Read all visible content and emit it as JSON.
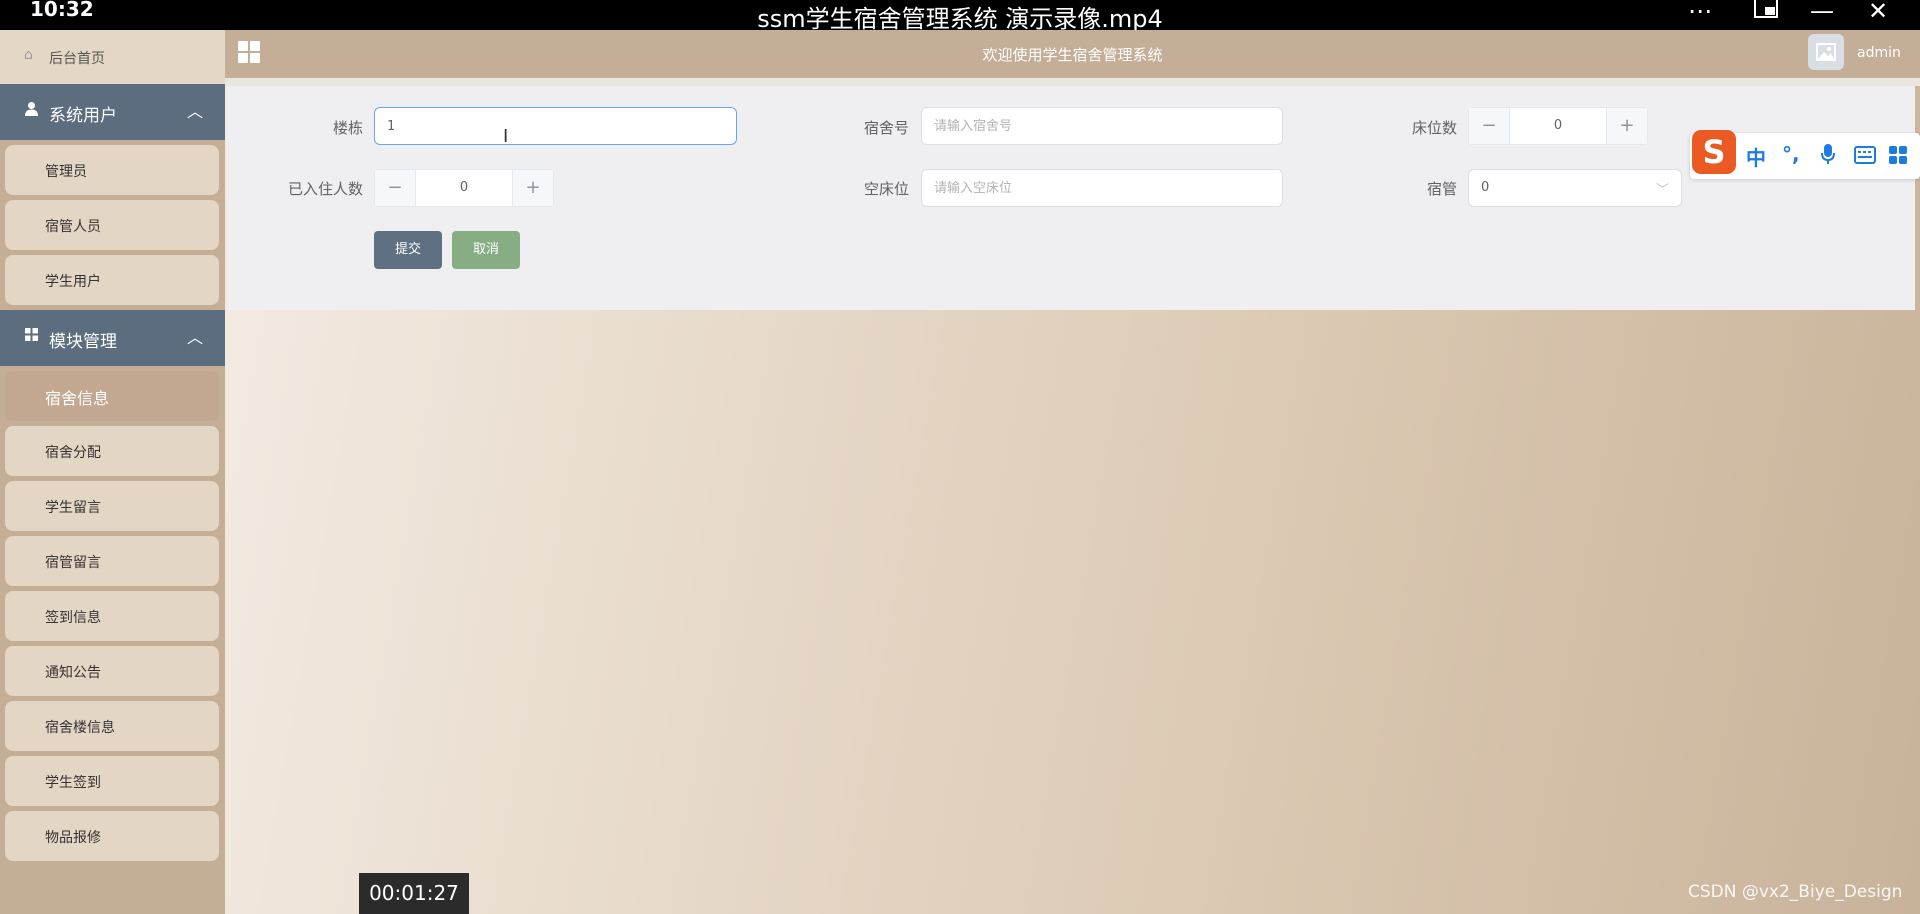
{
  "video": {
    "clock": "10:32",
    "title": "ssm学生宿舍管理系统 演示录像.mp4",
    "controls": [
      "more-icon",
      "picture-in-picture-icon",
      "minimize-icon",
      "close-icon"
    ],
    "timecode": "00:01:27"
  },
  "sidebar": {
    "home": "后台首页",
    "groups": [
      {
        "label": "系统用户",
        "items": [
          "管理员",
          "宿管人员",
          "学生用户"
        ]
      },
      {
        "label": "模块管理",
        "items": [
          "宿舍信息",
          "宿舍分配",
          "学生留言",
          "宿管留言",
          "签到信息",
          "通知公告",
          "宿舍楼信息",
          "学生签到",
          "物品报修"
        ]
      }
    ],
    "active_item": "宿舍信息"
  },
  "header": {
    "welcome": "欢迎使用学生宿舍管理系统",
    "user": "admin"
  },
  "form": {
    "building": {
      "label": "楼栋",
      "value": "1"
    },
    "room_no": {
      "label": "宿舍号",
      "placeholder": "请输入宿舍号"
    },
    "beds": {
      "label": "床位数",
      "value": "0"
    },
    "occupied": {
      "label": "已入住人数",
      "value": "0"
    },
    "empty_beds": {
      "label": "空床位",
      "placeholder": "请输入空床位"
    },
    "manager": {
      "label": "宿管",
      "value": "0"
    },
    "submit": "提交",
    "cancel": "取消"
  },
  "ime": {
    "logo": "S",
    "lang": "中",
    "punct": "°,",
    "icons": [
      "microphone-icon",
      "keyboard-icon",
      "apps-grid-icon"
    ]
  },
  "watermark": "CSDN @vx2_Biye_Design",
  "colors": {
    "sidebar_group": "#5b6d7f",
    "header": "#c5ae97",
    "active_item": "#c2a890",
    "submit_button": "#5e7081",
    "cancel_button": "#86ad84",
    "ime_logo": "#ea5a22"
  }
}
